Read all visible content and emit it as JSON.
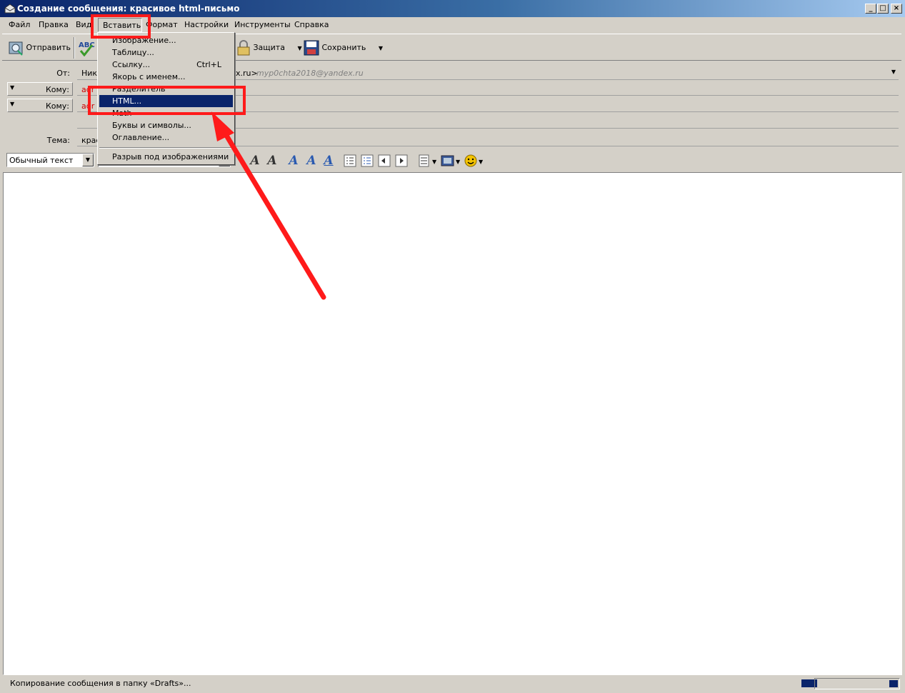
{
  "window": {
    "title": "Создание сообщения: красивое html-письмо",
    "controls": [
      "_",
      "□",
      "×"
    ]
  },
  "menubar": {
    "items": [
      "Файл",
      "Правка",
      "Вид",
      "Вставить",
      "Формат",
      "Настройки",
      "Инструменты",
      "Справка"
    ]
  },
  "toolbar": {
    "send_label": "Отправить",
    "spell_icon": "abc-check-icon",
    "security_label": "Защита",
    "save_label": "Сохранить"
  },
  "header": {
    "from_label": "От:",
    "from_value_left": "Ник",
    "from_value_right": "x.ru>",
    "from_email": "myp0chta2018@yandex.ru",
    "to_label": "Кому:",
    "to_value_1": "adr",
    "to_value_2": "adr",
    "subject_label": "Тема:",
    "subject_value": "крас"
  },
  "format": {
    "paragraph_style": "Обычный текст"
  },
  "insert_menu": {
    "items": [
      {
        "label": "Изображение...",
        "shortcut": ""
      },
      {
        "label": "Таблицу...",
        "shortcut": ""
      },
      {
        "label": "Ссылку...",
        "shortcut": "Ctrl+L"
      },
      {
        "label": "Якорь с именем...",
        "shortcut": ""
      },
      {
        "label": "Разделитель",
        "shortcut": ""
      },
      {
        "label": "HTML...",
        "shortcut": ""
      },
      {
        "label": "Math",
        "shortcut": ""
      },
      {
        "label": "Буквы и символы...",
        "shortcut": ""
      },
      {
        "label": "Оглавление...",
        "shortcut": ""
      },
      {
        "label": "Разрыв под изображениями",
        "shortcut": ""
      }
    ],
    "highlighted": "HTML..."
  },
  "statusbar": {
    "text": "Копирование сообщения в папку «Drafts»..."
  },
  "colors": {
    "titlebar": "#0a246a",
    "highlight": "#0a246a",
    "annotation": "#ff1a1a",
    "recipient_text": "#cc0000"
  }
}
